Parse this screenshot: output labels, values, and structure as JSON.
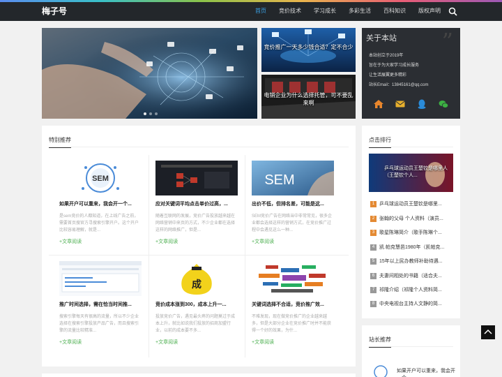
{
  "site": {
    "logo": "梅子号"
  },
  "nav": [
    {
      "label": "首页",
      "active": true
    },
    {
      "label": "竞价技术",
      "active": false
    },
    {
      "label": "学习成长",
      "active": false
    },
    {
      "label": "多彩生活",
      "active": false
    },
    {
      "label": "百科知识",
      "active": false
    },
    {
      "label": "版权声明",
      "active": false
    }
  ],
  "tiles": [
    {
      "title": "竞价推广一天多少钱合适？定不合少"
    },
    {
      "title": "电销企业为什么选择托管，可不要乱来啊"
    }
  ],
  "about": {
    "title": "关于本站",
    "lines": [
      "本站创立于2019年",
      "旨在于为大家学习成长服务",
      "让生活展翼更多精彩",
      "站长Email：13845161@qq.com"
    ]
  },
  "featured": {
    "title": "特别推荐",
    "more_label": "文章阅读",
    "posts": [
      {
        "title": "如果开户可以重来，我会开一个...",
        "desc": "是sem竞价的人都知道，在上线广告之前，需要首页搜官方寻搜索引擎开户。这个开户比较容易理解，就是..."
      },
      {
        "title": "应对关键词平均点击单价过高，...",
        "desc": "随着互联网的发展，竞价广告投放越来越在网络营销中来页的方式，不少企业都在选择这样的网络推广，但是..."
      },
      {
        "title": "出价不低，但排名差，可能是这...",
        "desc": "SEM竞价广告在网络当中非常常见，很多企业都会选择这样的营销方式，在竞价推广过程中会遇见这么一种..."
      },
      {
        "title": "推广时间选择，需在恰当时间推...",
        "desc": "搜索引擎每天有很高的流量，所以不少企业选择在搜索引擎投放产品广告，而且搜索引擎的流量比较精准..."
      },
      {
        "title": "竞价成本涨到300，成本上升一...",
        "desc": "投放竞价广告，遇见最头疼的问题莫过于成本上升，就比如说我们投放的招商加盟行业，以前的成本要不多..."
      },
      {
        "title": "关键词选择不合适，竞价推广效...",
        "desc": "不难发现，现在做竞价推广的企业越来越多，但是大部分企业在竞价推广时并不能获得一个好的效果，为什..."
      }
    ]
  },
  "ranking": {
    "title": "点击排行",
    "image_title": "乒乓球运动员王楚钦是哪里人（王楚钦个人...",
    "items": [
      "乒乓球运动员王楚钦是哪里...",
      "张翰的父母 个人资料（演员...",
      "歌星陈琳简介（歌手陈琳个...",
      "凯.帕克慧邑1980年（凯帕克...",
      "15年以上民办教师补助待遇...",
      "夫妻间相处的书籍（适合夫...",
      "祁隆介绍（祁隆个人资料简...",
      "中央电视台主持人文静的简..."
    ]
  },
  "webmaster": {
    "title": "站长推荐",
    "preview": "如果开户可以重来，我会开一个..."
  },
  "thumb_labels": {
    "sem": "SEM",
    "cheng": "成"
  }
}
